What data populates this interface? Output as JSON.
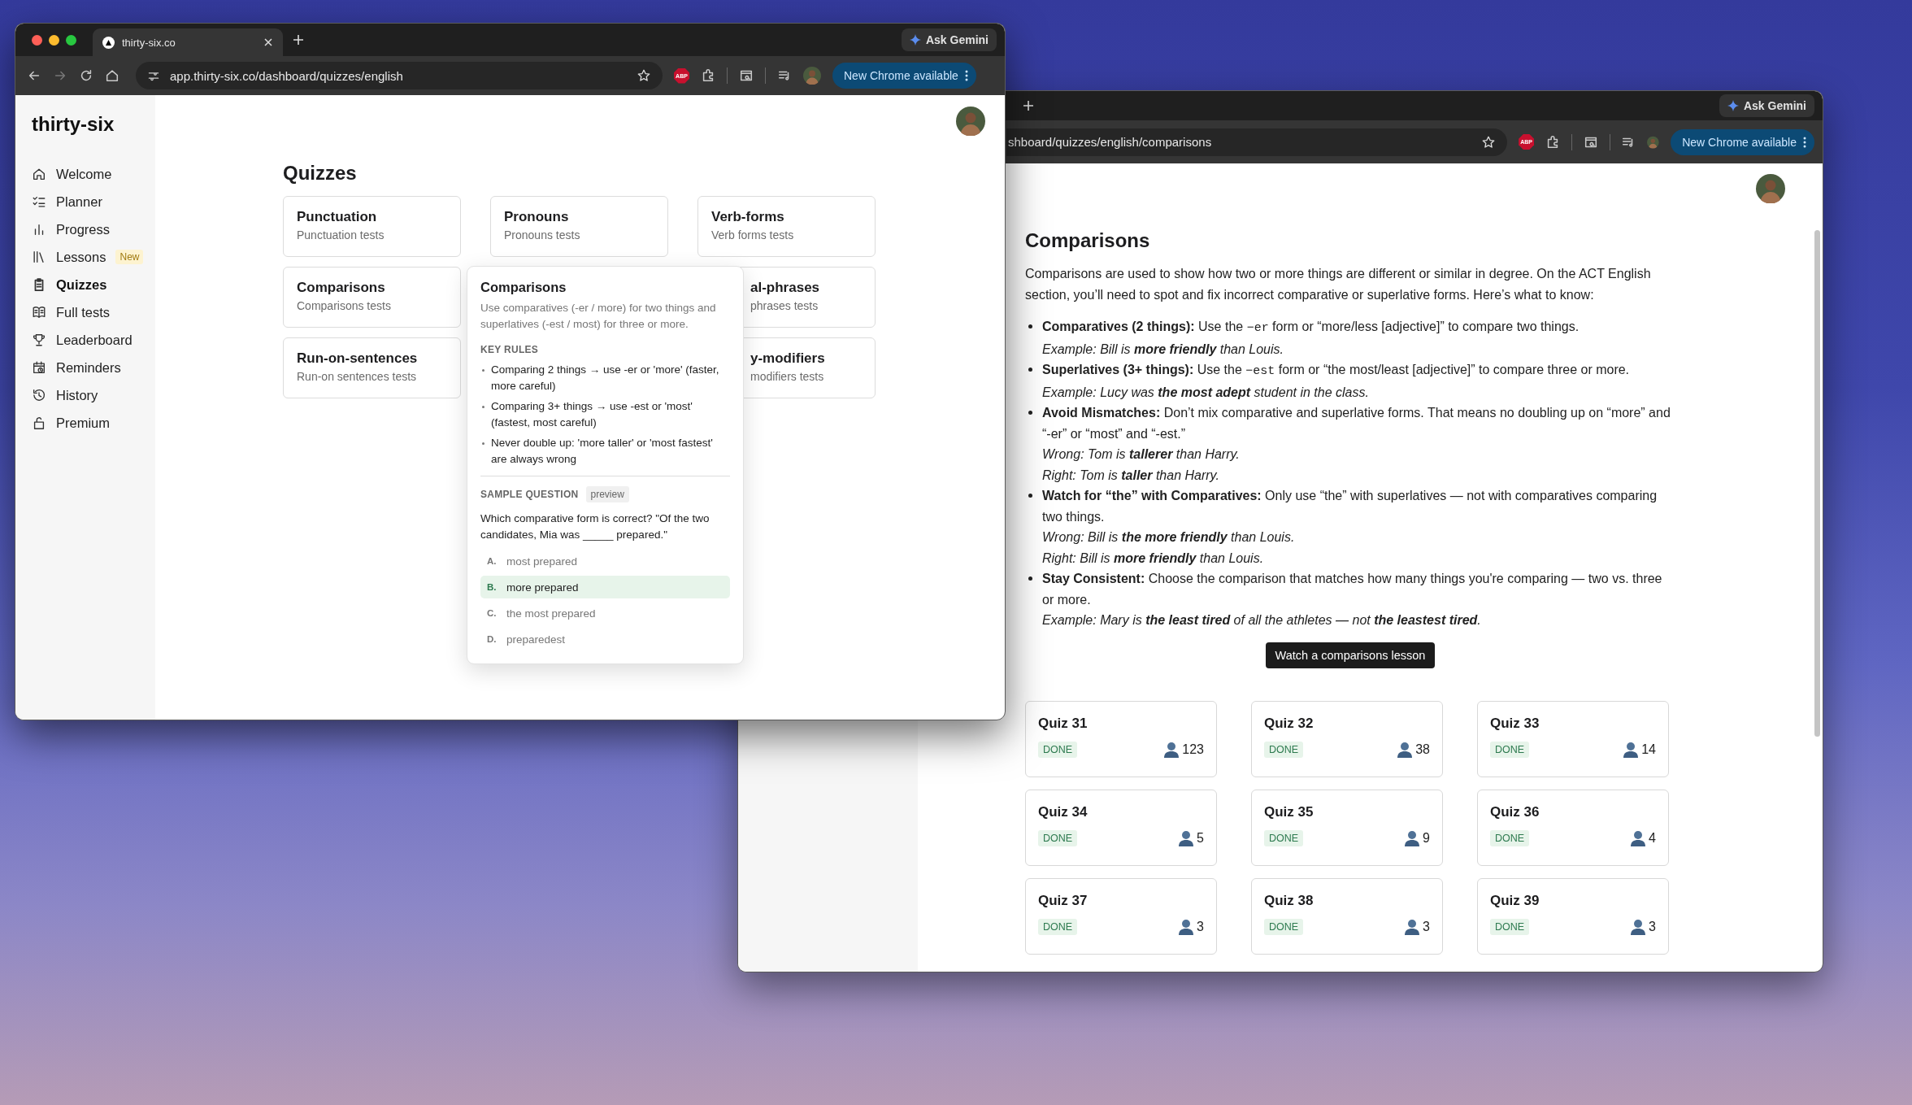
{
  "front_window": {
    "tab_title": "thirty-six.co",
    "ask_gemini": "Ask Gemini",
    "url": "app.thirty-six.co/dashboard/quizzes/english",
    "abp_label": "ABP",
    "update_button": "New Chrome available",
    "sidebar": {
      "logo": "thirty-six",
      "items": [
        {
          "label": "Welcome",
          "selected": false
        },
        {
          "label": "Planner",
          "selected": false
        },
        {
          "label": "Progress",
          "selected": false
        },
        {
          "label": "Lessons",
          "selected": false,
          "badge": "New"
        },
        {
          "label": "Quizzes",
          "selected": true
        },
        {
          "label": "Full tests",
          "selected": false
        },
        {
          "label": "Leaderboard",
          "selected": false
        },
        {
          "label": "Reminders",
          "selected": false
        },
        {
          "label": "History",
          "selected": false
        },
        {
          "label": "Premium",
          "selected": false
        }
      ]
    },
    "title": "Quizzes",
    "cards": [
      {
        "kind": "full",
        "title": "Punctuation",
        "subtitle": "Punctuation tests"
      },
      {
        "kind": "full",
        "title": "Pronouns",
        "subtitle": "Pronouns tests"
      },
      {
        "kind": "full",
        "title": "Verb-forms",
        "subtitle": "Verb forms tests"
      },
      {
        "kind": "full",
        "title": "Comparisons",
        "subtitle": "Comparisons tests"
      },
      {
        "kind": "partial",
        "title": "al-phrases",
        "subtitle": "phrases tests"
      },
      {
        "kind": "full",
        "title": "Run-on-sentences",
        "subtitle": "Run-on sentences tests"
      },
      {
        "kind": "partial",
        "title": "y-modifiers",
        "subtitle": "modifiers tests"
      }
    ],
    "popover": {
      "title": "Comparisons",
      "description": "Use comparatives (-er / more) for two things and superlatives (-est / most) for three or more.",
      "rules_heading": "KEY RULES",
      "rules": [
        "Comparing 2 things → use -er or 'more' (faster, more careful)",
        "Comparing 3+ things → use -est or 'most' (fastest, most careful)",
        "Never double up: 'more taller' or 'most fastest' are always wrong"
      ],
      "sample_heading": "SAMPLE QUESTION",
      "sample_badge": "preview",
      "question": "Which comparative form is correct? \"Of the two candidates, Mia was _____ prepared.\"",
      "options": [
        {
          "letter": "A.",
          "text": "most prepared",
          "selected": false
        },
        {
          "letter": "B.",
          "text": "more prepared",
          "selected": true
        },
        {
          "letter": "C.",
          "text": "the most prepared",
          "selected": false
        },
        {
          "letter": "D.",
          "text": "preparedest",
          "selected": false
        }
      ]
    }
  },
  "back_window": {
    "ask_gemini": "Ask Gemini",
    "url": "shboard/quizzes/english/comparisons",
    "abp_label": "ABP",
    "update_button": "New Chrome available",
    "title": "Comparisons",
    "intro": "Comparisons are used to show how two or more things are different or similar in degree. On the ACT English section, you’ll need to spot and fix incorrect comparative or superlative forms. Here’s what to know:",
    "rules": [
      {
        "lead": "Comparatives (2 things):",
        "segments": [
          {
            "kind": "text",
            "text": "Use the "
          },
          {
            "kind": "code",
            "text": "−er"
          },
          {
            "kind": "text",
            "text": " form or “more/less [adjective]” to compare two things."
          }
        ],
        "notes": [
          "Example: Bill is **more friendly** than Louis."
        ]
      },
      {
        "lead": "Superlatives (3+ things):",
        "segments": [
          {
            "kind": "text",
            "text": "Use the "
          },
          {
            "kind": "code",
            "text": "−est"
          },
          {
            "kind": "text",
            "text": " form or “the most/least [adjective]” to compare three or more."
          }
        ],
        "notes": [
          "Example: Lucy was **the most adept** student in the class."
        ]
      },
      {
        "lead": "Avoid Mismatches:",
        "segments": [
          {
            "kind": "text",
            "text": "Don’t mix comparative and superlative forms. That means no doubling up on “more” and “-er” or “most” and “-est.”"
          }
        ],
        "notes": [
          "Wrong: Tom is **tallerer** than Harry.",
          "Right: Tom is **taller** than Harry."
        ]
      },
      {
        "lead": "Watch for “the” with Comparatives:",
        "segments": [
          {
            "kind": "text",
            "text": "Only use “the” with superlatives — not with comparatives comparing two things."
          }
        ],
        "notes": [
          "Wrong: Bill is **the more friendly** than Louis.",
          "Right: Bill is **more friendly** than Louis."
        ]
      },
      {
        "lead": "Stay Consistent:",
        "segments": [
          {
            "kind": "text",
            "text": "Choose the comparison that matches how many things you're comparing — two vs. three or more."
          }
        ],
        "notes": [
          "Example: Mary is **the least tired** of all the athletes — not **the leastest tired**."
        ]
      }
    ],
    "lesson_button": "Watch a comparisons lesson",
    "quizzes": [
      {
        "title": "Quiz 31",
        "status": "DONE",
        "count": "123"
      },
      {
        "title": "Quiz 32",
        "status": "DONE",
        "count": "38"
      },
      {
        "title": "Quiz 33",
        "status": "DONE",
        "count": "14"
      },
      {
        "title": "Quiz 34",
        "status": "DONE",
        "count": "5"
      },
      {
        "title": "Quiz 35",
        "status": "DONE",
        "count": "9"
      },
      {
        "title": "Quiz 36",
        "status": "DONE",
        "count": "4"
      },
      {
        "title": "Quiz 37",
        "status": "DONE",
        "count": "3"
      },
      {
        "title": "Quiz 38",
        "status": "DONE",
        "count": "3"
      },
      {
        "title": "Quiz 39",
        "status": "DONE",
        "count": "3"
      }
    ]
  }
}
